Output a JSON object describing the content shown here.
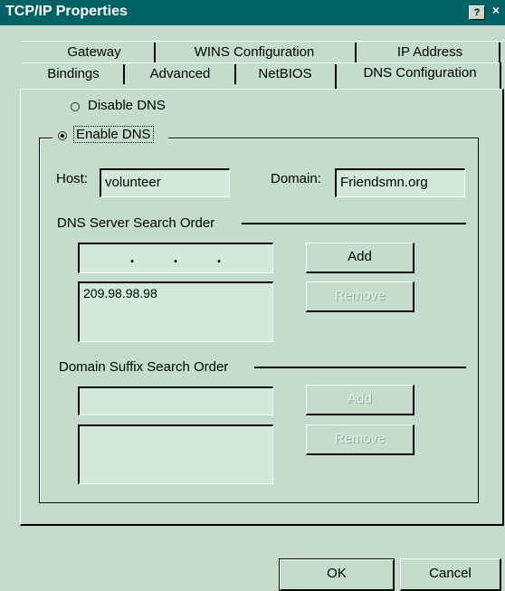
{
  "window": {
    "title": "TCP/IP Properties",
    "help_button": "?",
    "close_button": "×"
  },
  "tabs": {
    "row1": [
      "Gateway",
      "WINS Configuration",
      "IP Address"
    ],
    "row2": [
      "Bindings",
      "Advanced",
      "NetBIOS",
      "DNS Configuration"
    ],
    "active": "DNS Configuration"
  },
  "dns": {
    "disable_label": "Disable DNS",
    "enable_label": "Enable DNS",
    "selected": "enable",
    "host_label": "Host:",
    "host_value": "volunteer",
    "domain_label": "Domain:",
    "domain_value": "Friendsmn.org",
    "server_order_label": "DNS Server Search Order",
    "ip_dots": ".       .       .",
    "add_label": "Add",
    "remove_label": "Remove",
    "servers": [
      "209.98.98.98"
    ],
    "suffix_order_label": "Domain Suffix Search Order",
    "suffix_add_label": "Add",
    "suffix_remove_label": "Remove"
  },
  "footer": {
    "ok_label": "OK",
    "cancel_label": "Cancel"
  },
  "colors": {
    "titlebar": "#006264",
    "background": "#c4dccc",
    "field": "#d3e8dc"
  }
}
